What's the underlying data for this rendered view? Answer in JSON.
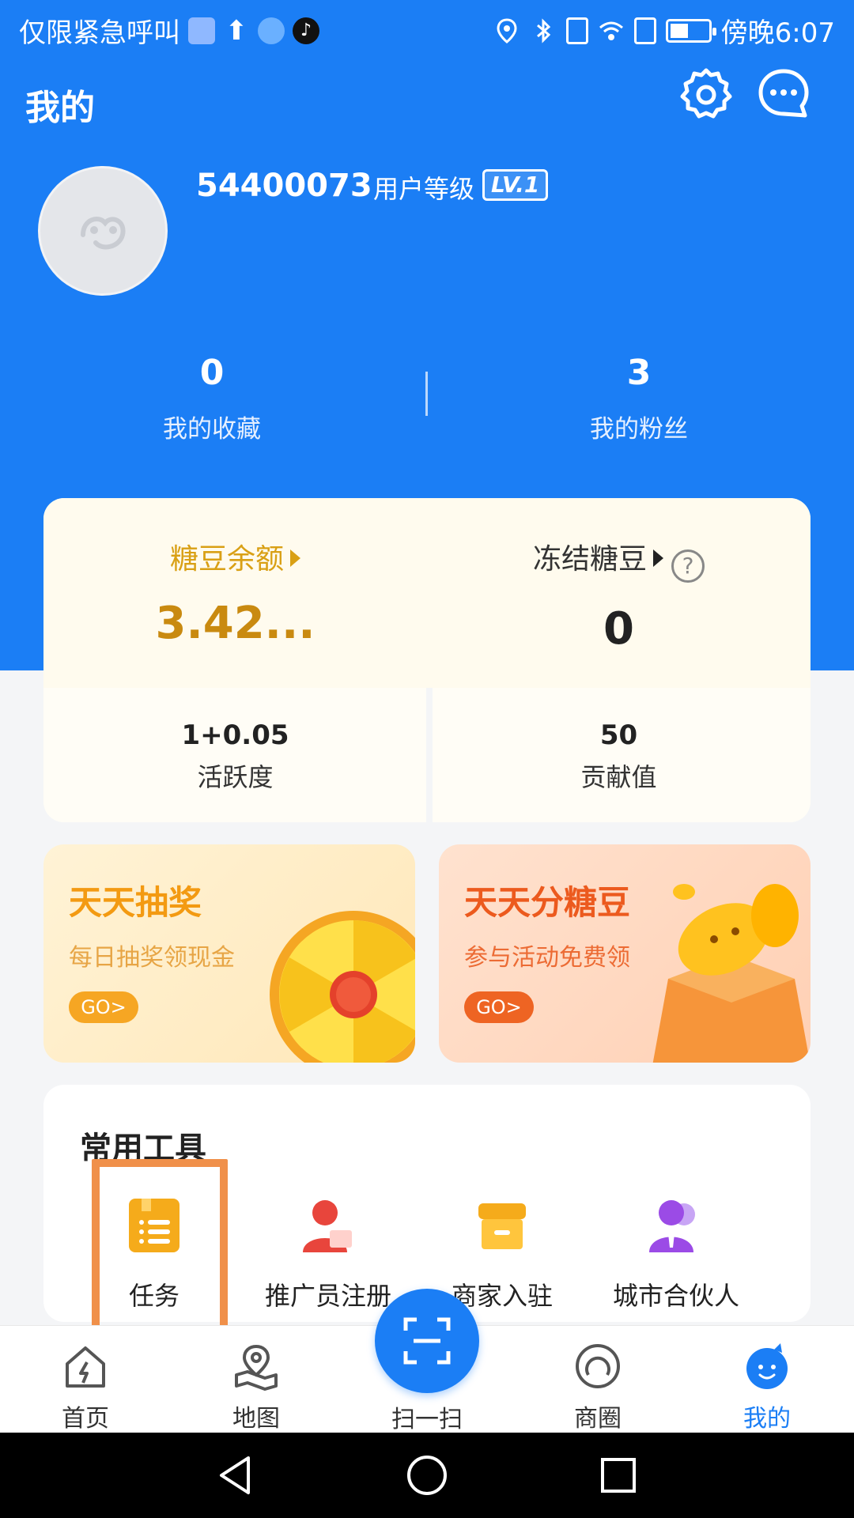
{
  "status_bar": {
    "left_text": "仅限紧急呼叫",
    "time": "傍晚6:07"
  },
  "header": {
    "title": "我的",
    "settings_icon": "gear-icon",
    "message_icon": "message-icon"
  },
  "profile": {
    "user_id": "54400073",
    "level_label": "用户等级",
    "level_badge": "LV.1",
    "stats": [
      {
        "value": "0",
        "label": "我的收藏"
      },
      {
        "value": "3",
        "label": "我的粉丝"
      }
    ]
  },
  "balance_card": {
    "balance_label": "糖豆余额",
    "balance_value": "3.42...",
    "frozen_label": "冻结糖豆",
    "frozen_value": "0",
    "help_symbol": "?",
    "activity_value": "1+0.05",
    "activity_label": "活跃度",
    "contribution_value": "50",
    "contribution_label": "贡献值"
  },
  "promos": [
    {
      "title": "天天抽奖",
      "desc": "每日抽奖领现金",
      "go": "GO>"
    },
    {
      "title": "天天分糖豆",
      "desc": "参与活动免费领",
      "go": "GO>"
    }
  ],
  "tools": {
    "heading": "常用工具",
    "items": [
      {
        "label": "任务",
        "icon": "task-list-icon"
      },
      {
        "label": "推广员注册",
        "icon": "promoter-icon"
      },
      {
        "label": "商家入驻",
        "icon": "store-icon"
      },
      {
        "label": "城市合伙人",
        "icon": "partner-icon"
      }
    ]
  },
  "bottom_nav": {
    "items": [
      {
        "label": "首页",
        "icon": "home-icon"
      },
      {
        "label": "地图",
        "icon": "map-icon"
      },
      {
        "label": "扫一扫",
        "icon": "scan-icon"
      },
      {
        "label": "商圈",
        "icon": "circle-icon"
      },
      {
        "label": "我的",
        "icon": "mascot-icon"
      }
    ]
  },
  "colors": {
    "primary_blue": "#1b7ef5",
    "gold": "#d9a015",
    "highlight_orange": "#f0904a"
  }
}
